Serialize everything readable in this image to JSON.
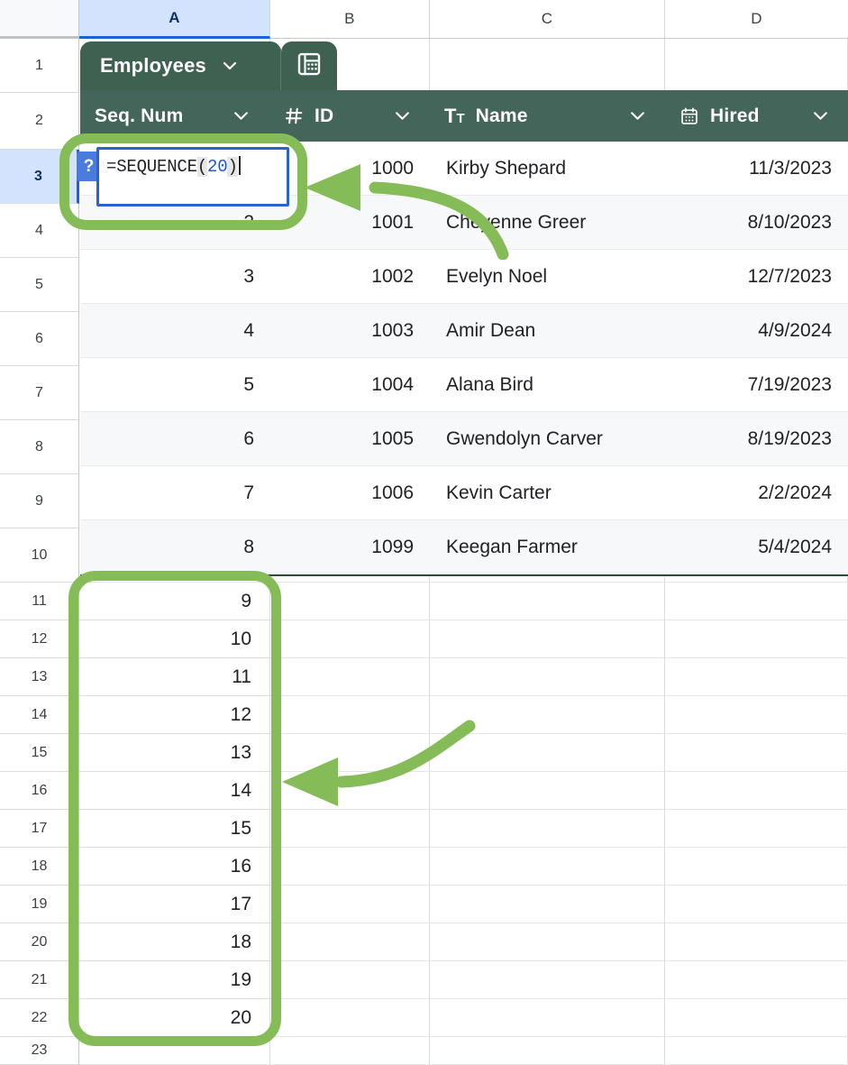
{
  "app": {
    "kind": "spreadsheet",
    "accent_green": "#86bc58",
    "table_header_green": "#44655a",
    "tab_green": "#3f6152",
    "selection_blue": "#2b63ce"
  },
  "grid": {
    "column_headers": [
      "A",
      "B",
      "C",
      "D"
    ],
    "selected_column": "A",
    "selected_row": "3",
    "row_numbers": [
      "1",
      "2",
      "3",
      "4",
      "5",
      "6",
      "7",
      "8",
      "9",
      "10",
      "11",
      "12",
      "13",
      "14",
      "15",
      "16",
      "17",
      "18",
      "19",
      "20",
      "21",
      "22",
      "23"
    ]
  },
  "table": {
    "tab_label": "Employees",
    "tab_chevron_icon": "chevron-down-icon",
    "tab_table_icon": "table-grid-icon",
    "columns": [
      {
        "label": "Seq. Num",
        "type_icon": "hash-icon",
        "chevron": "chevron-down-icon",
        "align": "right"
      },
      {
        "label": "ID",
        "type_icon": "hash-icon",
        "chevron": "chevron-down-icon",
        "align": "right"
      },
      {
        "label": "Name",
        "type_icon": "text-type-icon",
        "chevron": "chevron-down-icon",
        "align": "left"
      },
      {
        "label": "Hired",
        "type_icon": "calendar-icon",
        "chevron": "chevron-down-icon",
        "align": "right"
      }
    ],
    "rows": [
      {
        "seq": "",
        "id": "1000",
        "name": "Kirby Shepard",
        "hired": "11/3/2023"
      },
      {
        "seq": "2",
        "id": "1001",
        "name": "Cheyenne Greer",
        "hired": "8/10/2023"
      },
      {
        "seq": "3",
        "id": "1002",
        "name": "Evelyn Noel",
        "hired": "12/7/2023"
      },
      {
        "seq": "4",
        "id": "1003",
        "name": "Amir Dean",
        "hired": "4/9/2024"
      },
      {
        "seq": "5",
        "id": "1004",
        "name": "Alana Bird",
        "hired": "7/19/2023"
      },
      {
        "seq": "6",
        "id": "1005",
        "name": "Gwendolyn Carver",
        "hired": "8/19/2023"
      },
      {
        "seq": "7",
        "id": "1006",
        "name": "Kevin Carter",
        "hired": "2/2/2024"
      },
      {
        "seq": "8",
        "id": "1099",
        "name": "Keegan Farmer",
        "hired": "5/4/2024"
      }
    ]
  },
  "spill_values": [
    "9",
    "10",
    "11",
    "12",
    "13",
    "14",
    "15",
    "16",
    "17",
    "18",
    "19",
    "20"
  ],
  "formula_editor": {
    "badge": "?",
    "prefix": "=SEQUENCE",
    "open_paren": "(",
    "argument": "20",
    "close_paren": ")"
  },
  "annotations": {
    "highlight_formula_label": "formula-cell-highlight",
    "highlight_spill_label": "spill-range-highlight",
    "arrow_top_label": "arrow-pointing-to-formula",
    "arrow_bottom_label": "arrow-pointing-to-spill"
  }
}
